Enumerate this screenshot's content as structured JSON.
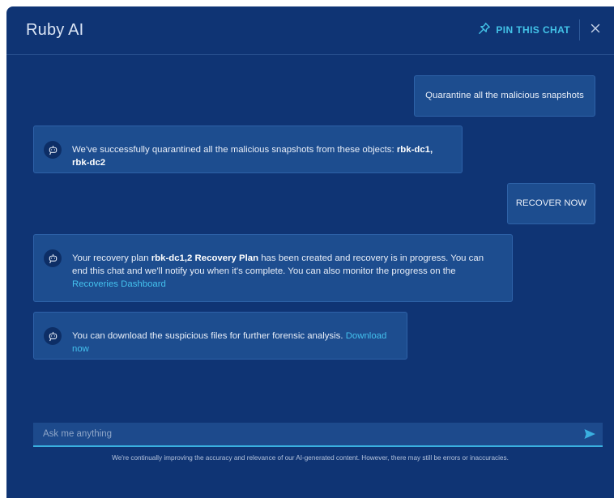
{
  "header": {
    "title": "Ruby AI",
    "pin_label": "PIN THIS CHAT"
  },
  "messages": [
    {
      "role": "user",
      "text": "Quarantine all the malicious snapshots"
    },
    {
      "role": "bot",
      "text": "We've successfully quarantined all the malicious snapshots from these objects: ",
      "bold": "rbk-dc1, rbk-dc2"
    },
    {
      "role": "user",
      "text": "RECOVER NOW"
    },
    {
      "role": "bot",
      "pre": "Your recovery plan ",
      "bold": "rbk-dc1,2 Recovery Plan",
      "post": " has been created and recovery is in progress. You can end this chat and we'll notify you when it's complete.  You can also monitor the progress on the ",
      "link": "Recoveries Dashboard"
    },
    {
      "role": "bot",
      "text": "You can download the suspicious files for further forensic analysis. ",
      "link": "Download now"
    }
  ],
  "input": {
    "placeholder": "Ask me anything",
    "value": ""
  },
  "disclaimer": "We're continually improving the accuracy and relevance of our AI-generated content. However, there may still be errors or inaccuracies.",
  "icons": {
    "pin": "pin-icon",
    "close": "close-icon",
    "bot": "robot-icon",
    "send": "send-icon"
  },
  "colors": {
    "panel_bg": "#0f3474",
    "bubble_bg": "#1d4d8f",
    "accent": "#43c3e8",
    "link": "#44c1ee"
  }
}
